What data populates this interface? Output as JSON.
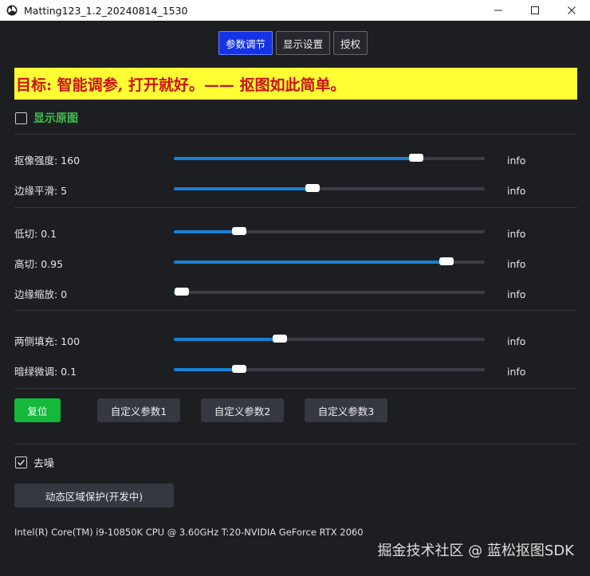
{
  "window": {
    "title": "Matting123_1.2_20240814_1530"
  },
  "tabs": [
    {
      "label": "参数调节",
      "active": true
    },
    {
      "label": "显示设置",
      "active": false
    },
    {
      "label": "授权",
      "active": false
    }
  ],
  "banner": {
    "text": "目标: 智能调参, 打开就好。—— 抠图如此简单。"
  },
  "show_original": {
    "label": "显示原图",
    "checked": false
  },
  "sliders": [
    {
      "label": "抠像强度: 160",
      "fraction": 0.78,
      "info": "info"
    },
    {
      "label": "边缘平滑: 5",
      "fraction": 0.445,
      "info": "info"
    },
    {
      "label": "低切: 0.1",
      "fraction": 0.21,
      "info": "info"
    },
    {
      "label": "高切: 0.95",
      "fraction": 0.878,
      "info": "info"
    },
    {
      "label": "边缘缩放: 0",
      "fraction": 0.025,
      "info": "info"
    },
    {
      "label": "两侧填充: 100",
      "fraction": 0.34,
      "info": "info"
    },
    {
      "label": "暗绿微调: 0.1",
      "fraction": 0.21,
      "info": "info"
    }
  ],
  "buttons": {
    "reset": "复位",
    "custom1": "自定义参数1",
    "custom2": "自定义参数2",
    "custom3": "自定义参数3",
    "dynamic": "动态区域保护(开发中)"
  },
  "denoise": {
    "label": "去噪",
    "checked": true
  },
  "system_info": "Intel(R) Core(TM) i9-10850K CPU @ 3.60GHz T:20-NVIDIA GeForce RTX 2060",
  "watermark": "掘金技术社区 @ 蓝松抠图SDK",
  "colors": {
    "accent": "#1a7fd6",
    "banner_bg": "#ffff33",
    "banner_text": "#d01010",
    "reset_green": "#14b83a",
    "active_tab": "#1533e6"
  }
}
